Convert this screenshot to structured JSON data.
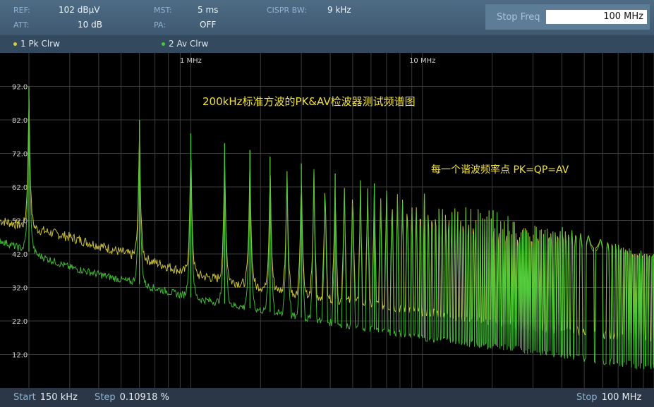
{
  "header": {
    "ref_label": "REF:",
    "ref_value": "102 dBµV",
    "att_label": "ATT:",
    "att_value": "10 dB",
    "mst_label": "MST:",
    "mst_value": "5 ms",
    "pa_label": "PA:",
    "pa_value": "OFF",
    "cispr_label": "CISPR BW:",
    "cispr_value": "9 kHz",
    "stop_freq_label": "Stop Freq",
    "stop_freq_value": "100 MHz"
  },
  "traces": {
    "trace1_label": "1 Pk  Clrw",
    "trace2_label": "2 Av  Clrw"
  },
  "footer": {
    "start_label": "Start",
    "start_value": "150 kHz",
    "step_label": "Step",
    "step_value": "0.10918 %",
    "stop_label": "Stop",
    "stop_value": "100 MHz"
  },
  "colors": {
    "pk_trace": "#d9cf3e",
    "av_trace": "#45c83a",
    "annotation": "#f2e23a",
    "grid": "#3c3c3c"
  },
  "chart_data": {
    "type": "line",
    "title": "200kHz标准方波的PK&AV检波器测试频谱图",
    "annotation": "每一个谐波频率点 PK=QP=AV",
    "x_scale": "log",
    "x_range_hz": [
      150000,
      100000000
    ],
    "x_tick_labels": [
      {
        "label": "1 MHz",
        "value_hz": 1000000
      },
      {
        "label": "10 MHz",
        "value_hz": 10000000
      }
    ],
    "y_range": [
      2,
      102
    ],
    "y_ticks": [
      12.0,
      22.0,
      32.0,
      42.0,
      52.0,
      62.0,
      72.0,
      82.0,
      92.0
    ],
    "fundamental_hz": 200000,
    "series": [
      {
        "name": "1 Pk  Clrw",
        "description_values": "harmonic peaks",
        "harmonic_peaks_dbuv": [
          {
            "freq_mhz": 0.2,
            "level": 92
          },
          {
            "freq_mhz": 0.6,
            "level": 82
          },
          {
            "freq_mhz": 1.0,
            "level": 78
          },
          {
            "freq_mhz": 1.4,
            "level": 75
          },
          {
            "freq_mhz": 1.8,
            "level": 73
          },
          {
            "freq_mhz": 2.2,
            "level": 71
          },
          {
            "freq_mhz": 3.0,
            "level": 69
          },
          {
            "freq_mhz": 4.2,
            "level": 66
          },
          {
            "freq_mhz": 6.2,
            "level": 63
          },
          {
            "freq_mhz": 10.2,
            "level": 60
          },
          {
            "freq_mhz": 20.2,
            "level": 55
          },
          {
            "freq_mhz": 40.2,
            "level": 50
          },
          {
            "freq_mhz": 99.8,
            "level": 42
          }
        ],
        "noise_floor": [
          {
            "freq_mhz": 0.15,
            "level": 52
          },
          {
            "freq_mhz": 0.3,
            "level": 47
          },
          {
            "freq_mhz": 0.6,
            "level": 41
          },
          {
            "freq_mhz": 1.0,
            "level": 36
          },
          {
            "freq_mhz": 3.0,
            "level": 30
          },
          {
            "freq_mhz": 10.0,
            "level": 25
          },
          {
            "freq_mhz": 30.0,
            "level": 20
          },
          {
            "freq_mhz": 100.0,
            "level": 17
          }
        ]
      },
      {
        "name": "2 Av  Clrw",
        "harmonic_peaks_dbuv": [
          {
            "freq_mhz": 0.2,
            "level": 92
          },
          {
            "freq_mhz": 0.6,
            "level": 82
          },
          {
            "freq_mhz": 1.0,
            "level": 78
          },
          {
            "freq_mhz": 1.4,
            "level": 75
          },
          {
            "freq_mhz": 1.8,
            "level": 73
          },
          {
            "freq_mhz": 2.2,
            "level": 71
          },
          {
            "freq_mhz": 3.0,
            "level": 69
          },
          {
            "freq_mhz": 4.2,
            "level": 66
          },
          {
            "freq_mhz": 6.2,
            "level": 63
          },
          {
            "freq_mhz": 10.2,
            "level": 60
          },
          {
            "freq_mhz": 20.2,
            "level": 55
          },
          {
            "freq_mhz": 40.2,
            "level": 50
          },
          {
            "freq_mhz": 99.8,
            "level": 42
          }
        ],
        "noise_floor": [
          {
            "freq_mhz": 0.15,
            "level": 46
          },
          {
            "freq_mhz": 0.3,
            "level": 38
          },
          {
            "freq_mhz": 0.6,
            "level": 33
          },
          {
            "freq_mhz": 1.0,
            "level": 29
          },
          {
            "freq_mhz": 3.0,
            "level": 23
          },
          {
            "freq_mhz": 10.0,
            "level": 17
          },
          {
            "freq_mhz": 30.0,
            "level": 13
          },
          {
            "freq_mhz": 100.0,
            "level": 8
          }
        ]
      }
    ]
  }
}
